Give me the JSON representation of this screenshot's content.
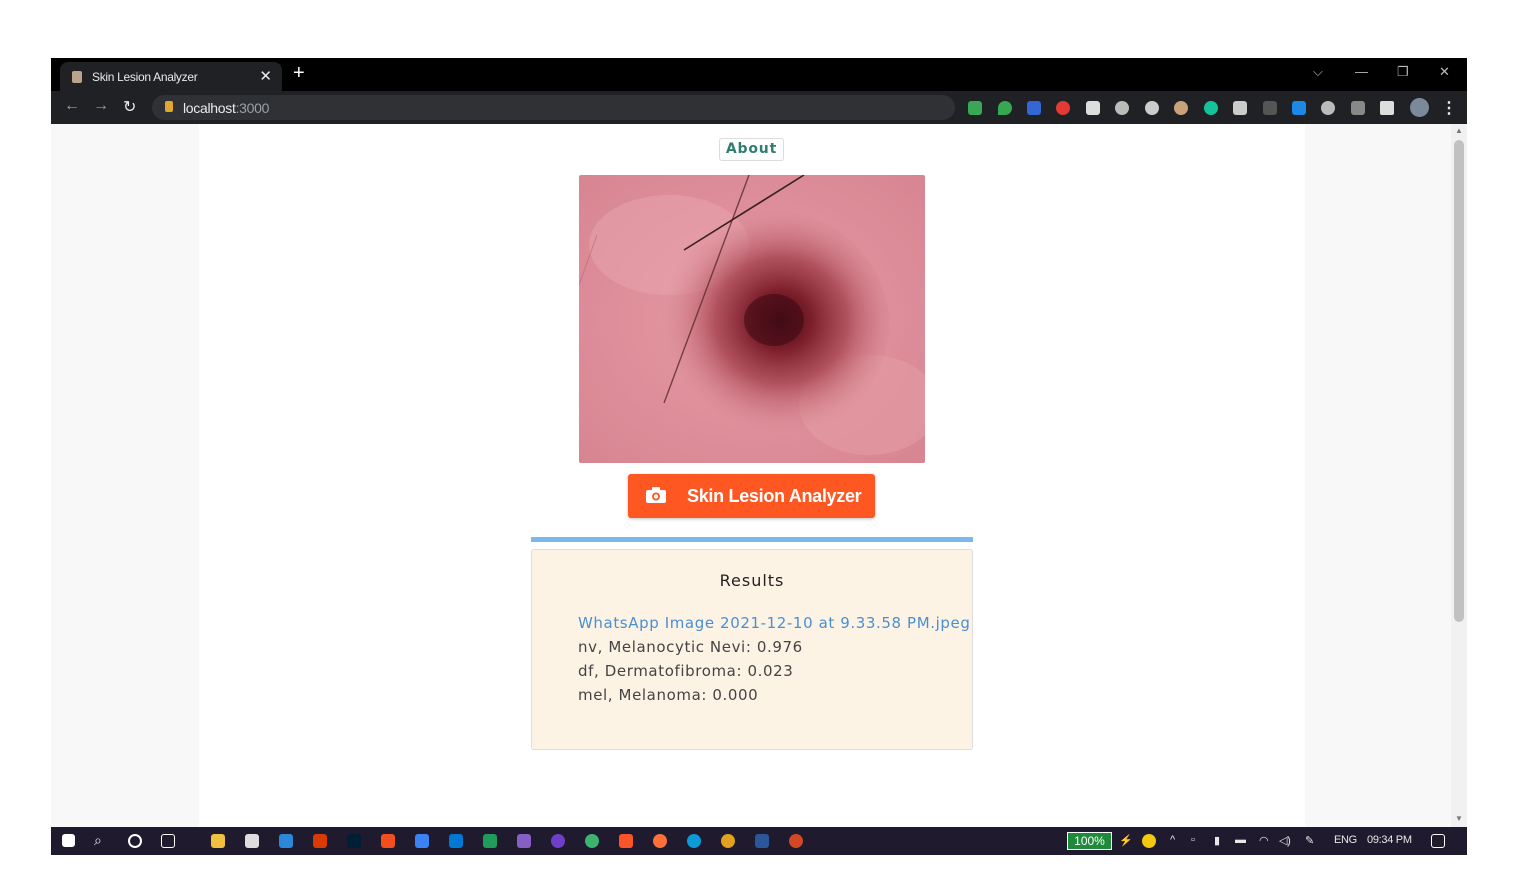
{
  "browser": {
    "tab_title": "Skin Lesion Analyzer",
    "new_tab": "+",
    "url_host": "localhost",
    "url_port": ":3000"
  },
  "page": {
    "about_label": "About",
    "analyze_label": "Skin Lesion Analyzer",
    "progress": 1.0,
    "results": {
      "header": "Results",
      "filename": "WhatsApp Image 2021-12-10 at 9.33.58 PM.jpeg",
      "predictions": [
        "nv, Melanocytic Nevi: 0.976",
        "df, Dermatofibroma: 0.023",
        "mel, Melanoma: 0.000"
      ]
    }
  },
  "taskbar": {
    "battery": "100%",
    "language": "ENG",
    "time": "09:34 PM"
  },
  "colors": {
    "accent": "#ff5722",
    "link": "#4a8fd4",
    "results_bg": "#fdf3e4"
  }
}
